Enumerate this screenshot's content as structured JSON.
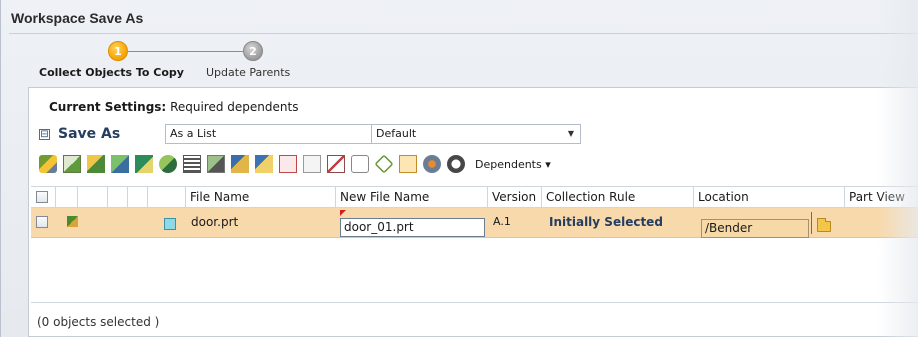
{
  "window": {
    "title": "Workspace Save As"
  },
  "stepper": {
    "steps": [
      {
        "number": "1",
        "label": "Collect Objects To Copy",
        "state": "active"
      },
      {
        "number": "2",
        "label": "Update Parents",
        "state": "inactive"
      }
    ]
  },
  "settings": {
    "prefix": "Current Settings:",
    "value": "Required dependents"
  },
  "save_as": {
    "collapse_symbol": "⊟",
    "label": "Save As",
    "mode_value": "As a List",
    "profile_value": "Default",
    "dropdown_arrow": "▼"
  },
  "toolbar": {
    "dependents_label": "Dependents",
    "dependents_arrow": "▾"
  },
  "table": {
    "columns": [
      "File Name",
      "New File Name",
      "Version",
      "Collection Rule",
      "Location",
      "Part View"
    ],
    "rows": [
      {
        "file_name": "door.prt",
        "new_file_name": "door_01.prt",
        "version": "A.1",
        "collection_rule": "Initially Selected",
        "location": "/Bender"
      }
    ]
  },
  "status": {
    "text": "(0 objects selected )"
  },
  "colors": {
    "accent": "#f5a200",
    "row_highlight": "#f8d9ab",
    "label_blue": "#243d61"
  },
  "icons": [
    "add-component-icon",
    "tree-icon",
    "copy-yellow-icon",
    "copy-green-icon",
    "edit-icon",
    "gem-icon",
    "list-icon",
    "grid-icon",
    "move-up-icon",
    "move-down-icon",
    "delete-icon",
    "frame-icon",
    "no-icon",
    "tag-icon",
    "recycle-icon",
    "folder-open-icon",
    "settings-icon",
    "undo-icon"
  ]
}
